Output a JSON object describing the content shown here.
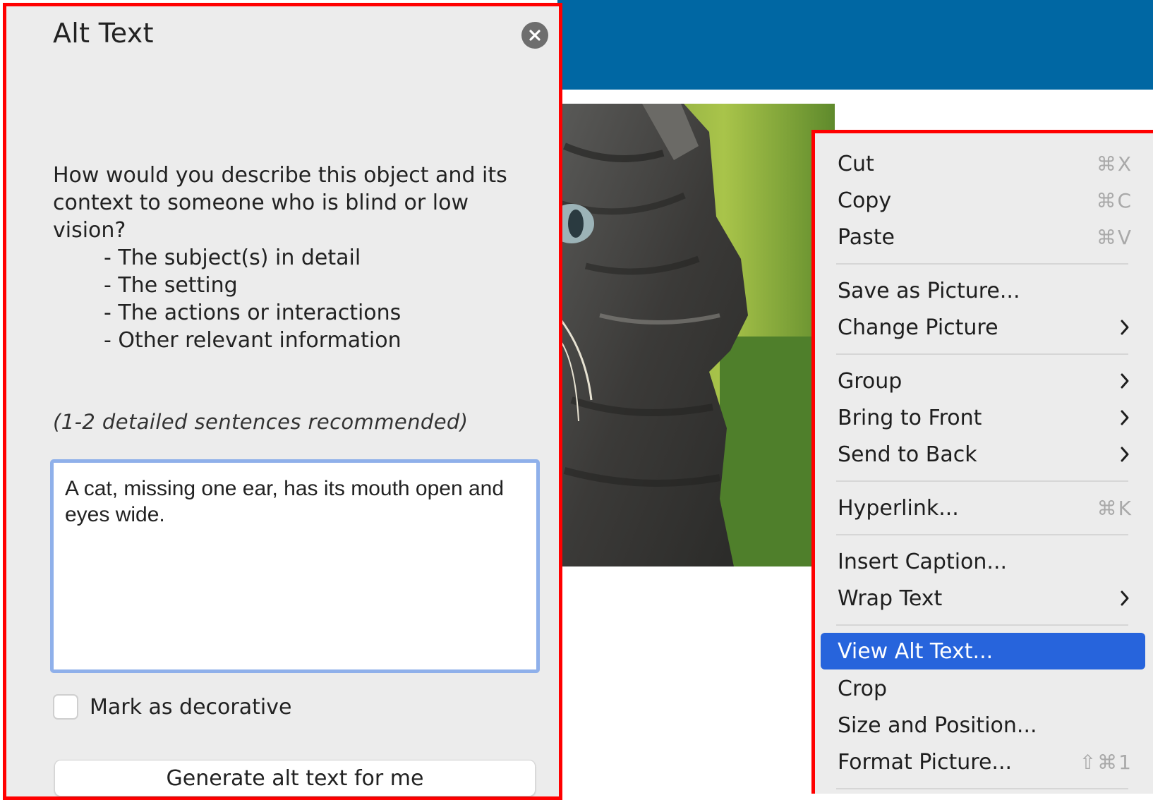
{
  "pane": {
    "title": "Alt Text",
    "question": "How would you describe this object and its context to someone who is blind or low vision?",
    "bullets": [
      "- The subject(s) in detail",
      "- The setting",
      "- The actions or interactions",
      "- Other relevant information"
    ],
    "recommendation": "(1-2 detailed sentences recommended)",
    "alt_text_value": "A cat, missing one ear, has its mouth open and eyes wide.",
    "decorative_label": "Mark as decorative",
    "decorative_checked": false,
    "generate_button": "Generate alt text for me"
  },
  "menu": {
    "items": [
      {
        "label": "Cut",
        "shortcut": "⌘X"
      },
      {
        "label": "Copy",
        "shortcut": "⌘C"
      },
      {
        "label": "Paste",
        "shortcut": "⌘V"
      },
      {
        "label": "Save as Picture..."
      },
      {
        "label": "Change Picture",
        "submenu": true
      },
      {
        "label": "Group",
        "submenu": true
      },
      {
        "label": "Bring to Front",
        "submenu": true
      },
      {
        "label": "Send to Back",
        "submenu": true
      },
      {
        "label": "Hyperlink...",
        "shortcut": "⌘K"
      },
      {
        "label": "Insert Caption..."
      },
      {
        "label": "Wrap Text",
        "submenu": true
      },
      {
        "label": "View Alt Text...",
        "highlighted": true
      },
      {
        "label": "Crop"
      },
      {
        "label": "Size and Position..."
      },
      {
        "label": "Format Picture...",
        "shortcut": "⇧⌘1"
      }
    ]
  },
  "colors": {
    "ribbon_blue": "#0067a3",
    "highlight_blue": "#2764dc",
    "annotation_red": "#ff0000",
    "input_focus_border": "#8fb0ea"
  }
}
